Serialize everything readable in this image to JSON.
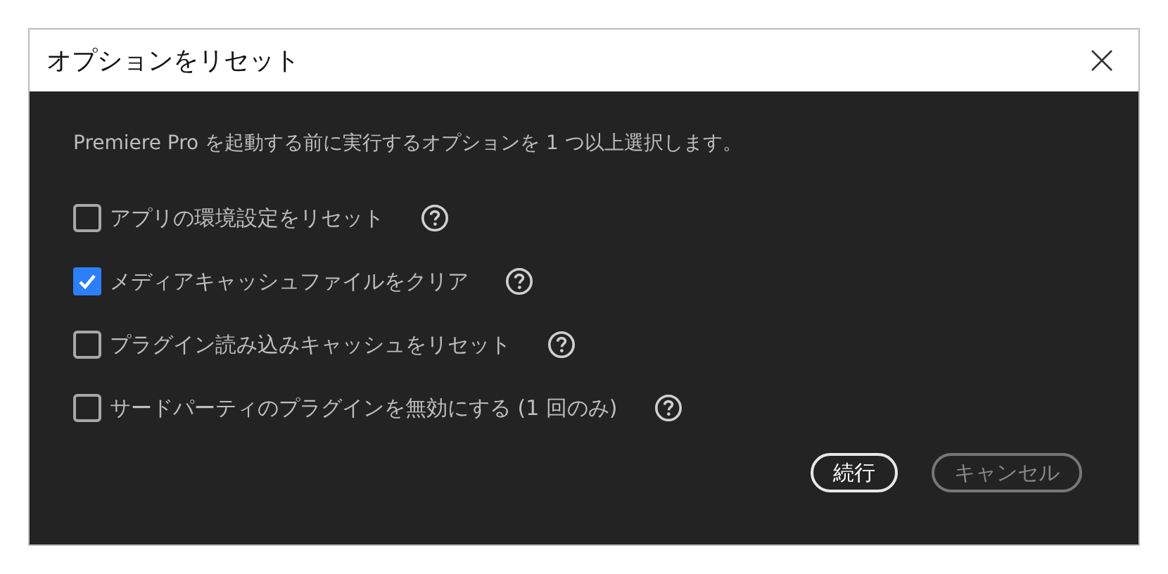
{
  "window": {
    "title": "オプションをリセット"
  },
  "description": "Premiere Pro を起動する前に実行するオプションを 1 つ以上選択します。",
  "options": [
    {
      "label": "アプリの環境設定をリセット",
      "checked": false
    },
    {
      "label": "メディアキャッシュファイルをクリア",
      "checked": true
    },
    {
      "label": "プラグイン読み込みキャッシュをリセット",
      "checked": false
    },
    {
      "label": "サードパーティのプラグインを無効にする (1 回のみ)",
      "checked": false
    }
  ],
  "buttons": [
    {
      "label": "続行",
      "disabled": false
    },
    {
      "label": "キャンセル",
      "disabled": true
    }
  ]
}
